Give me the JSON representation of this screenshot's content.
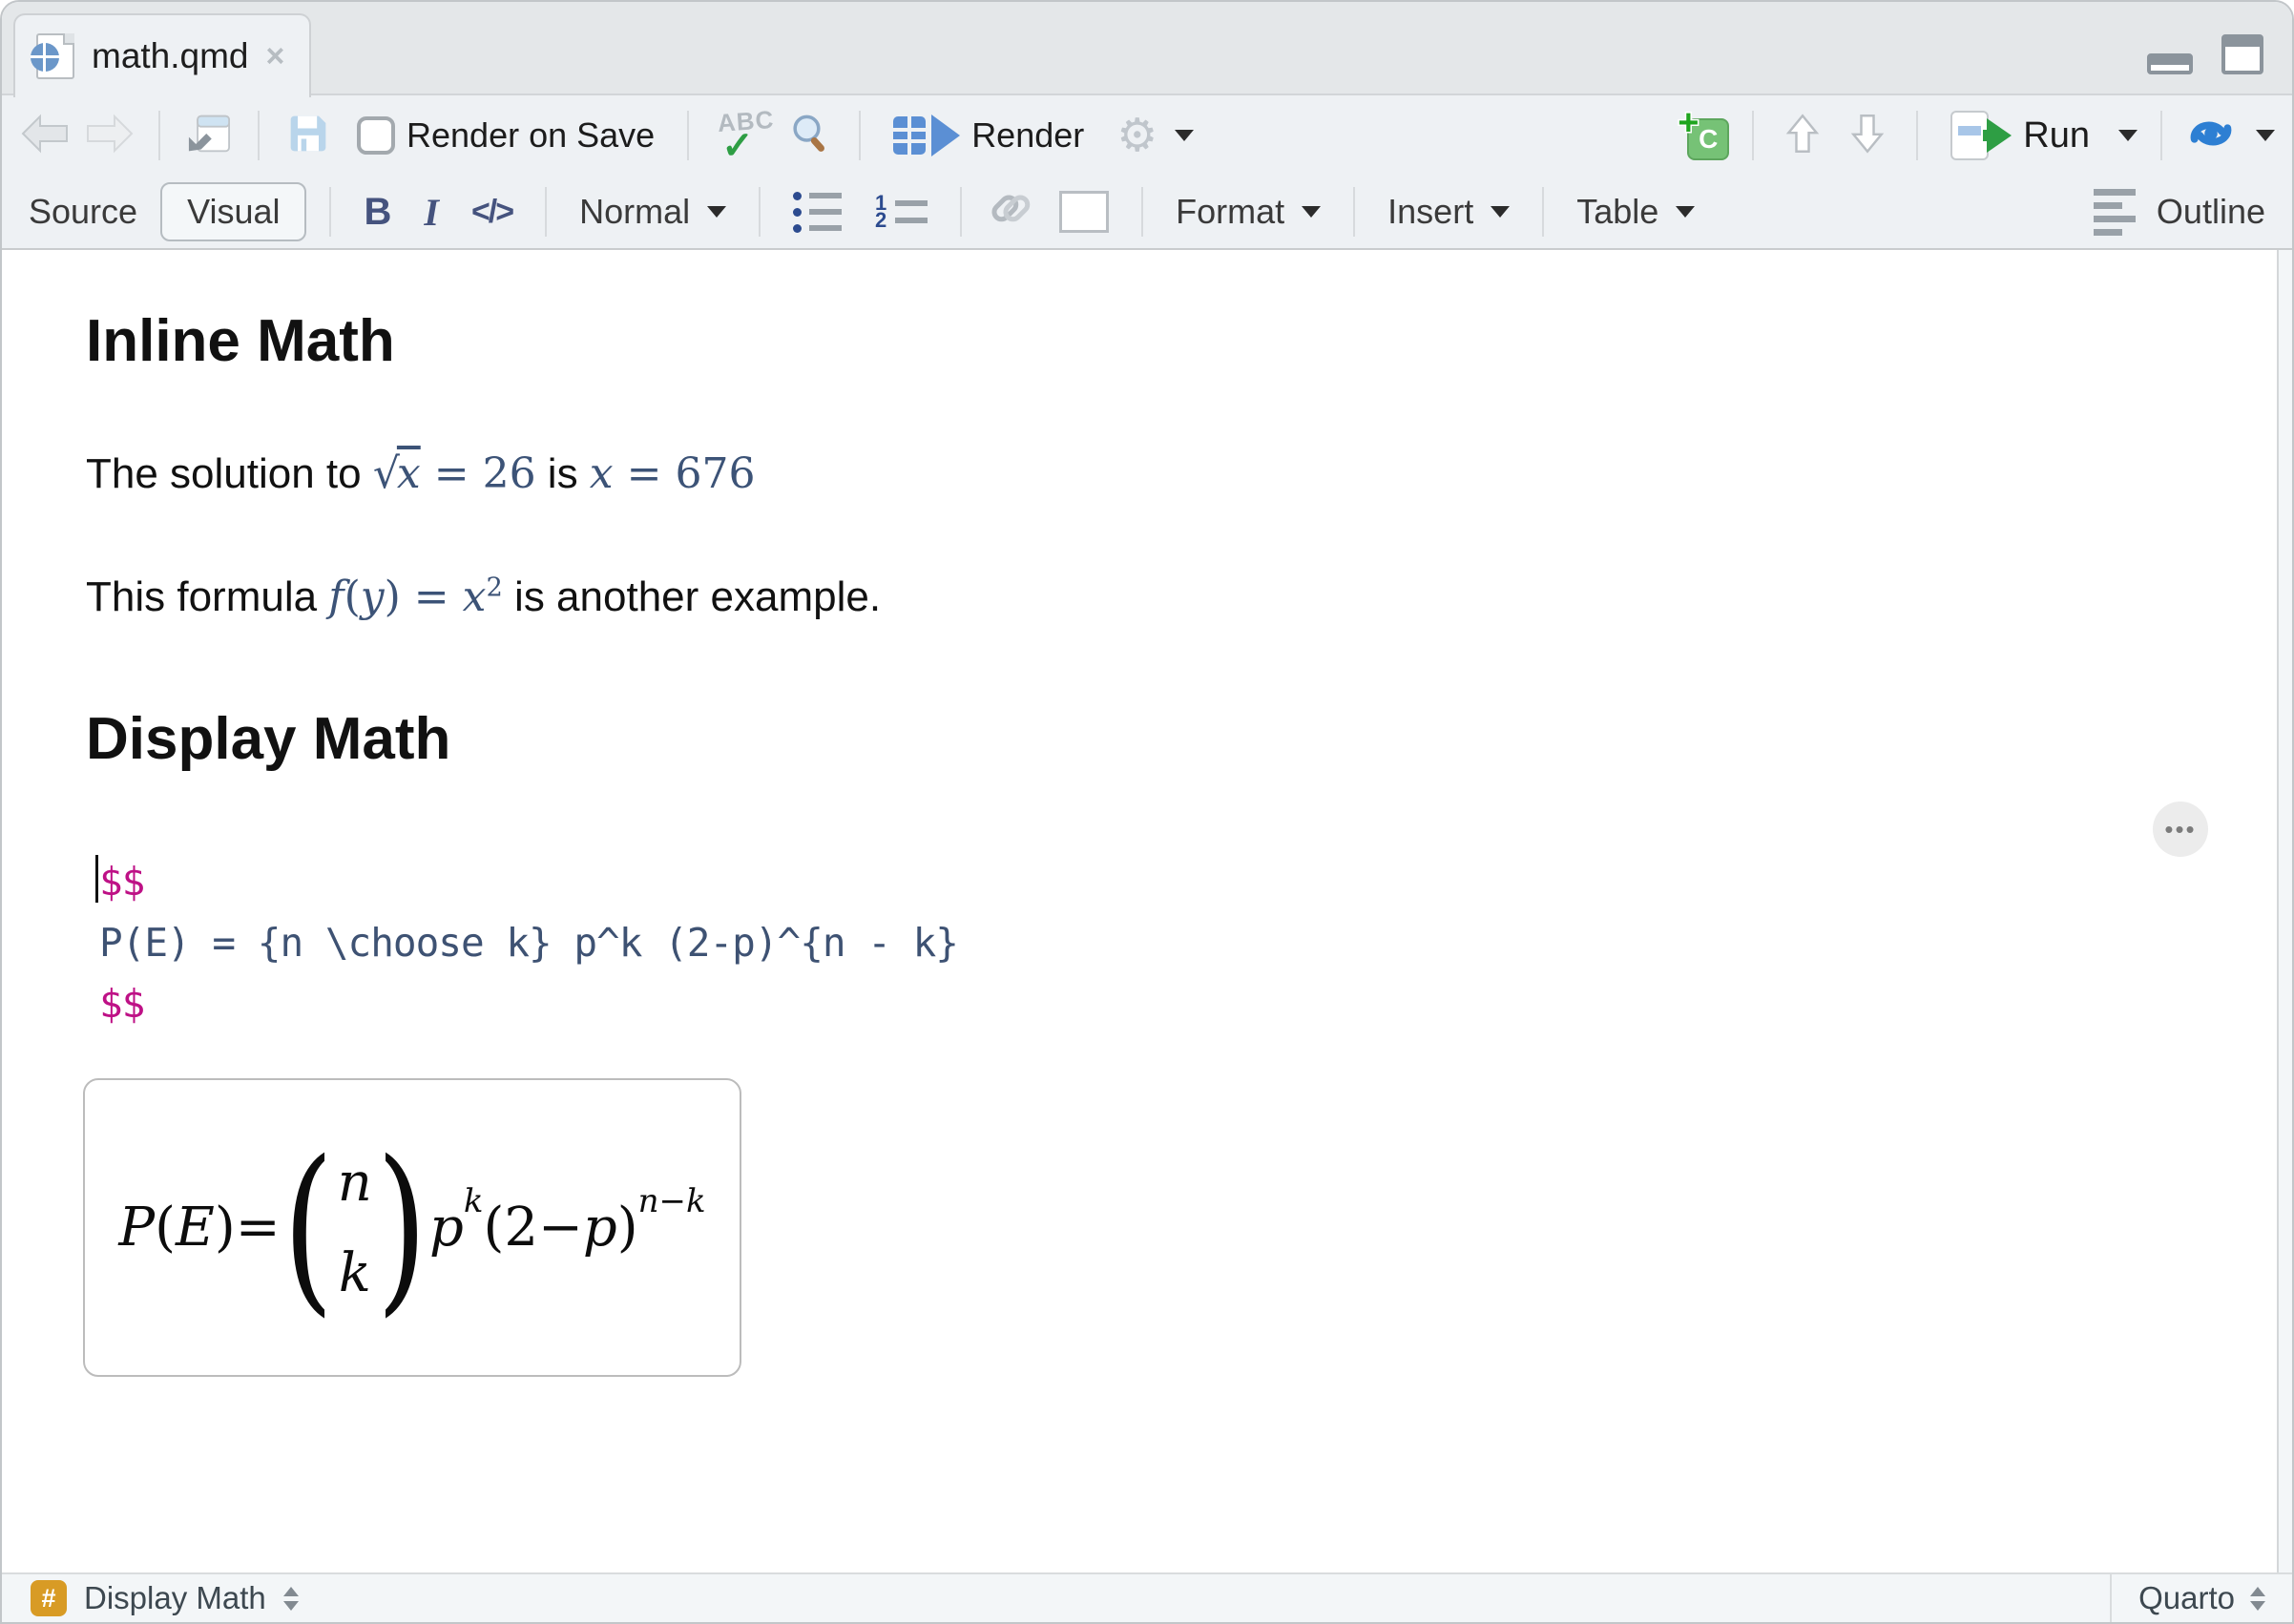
{
  "colors": {
    "math_blue": "#3C5377",
    "code_math_blue": "#3E5273",
    "dollar_magenta": "#BE1186",
    "hash_badge_orange": "#D89B25",
    "run_arrow_green": "#2E9E44",
    "chunk_green": "#76C276",
    "render_blue": "#5B8FD4",
    "sync_blue": "#2D7FD3",
    "toolbar_bg": "#EEF1F4",
    "tabbar_bg": "#E4E7E9"
  },
  "tab": {
    "title": "math.qmd",
    "close_glyph": "×"
  },
  "toolbar": {
    "render_on_save": "Render on Save",
    "spellcheck_abc": "ABC",
    "spellcheck_check": "✓",
    "render": "Render",
    "gear_glyph": "⚙",
    "chunk_plus": "+",
    "chunk_c": "C",
    "run": "Run"
  },
  "formatbar": {
    "source": "Source",
    "visual": "Visual",
    "bold": "B",
    "italic": "I",
    "code": "</>",
    "style": "Normal",
    "format": "Format",
    "insert": "Insert",
    "table": "Table",
    "outline": "Outline"
  },
  "doc": {
    "h1_inline": "Inline Math",
    "p1_before": "The solution to ",
    "p1_sqrt": "√",
    "p1_sqrt_arg": "x",
    "p1_math1_rest": " = 26",
    "p1_mid": " is ",
    "p1_math2_var": "x",
    "p1_math2_rest": " = 676",
    "p2_before": "This formula ",
    "p2_f": "f",
    "p2_open": "(",
    "p2_y": "y",
    "p2_close": ")",
    "p2_eq": " = ",
    "p2_x": "x",
    "p2_sup": "2",
    "p2_after": " is another example.",
    "h1_display": "Display Math",
    "code": {
      "line1": "$$",
      "line2": "P(E) = {n \\choose k} p^k (2-p)^{n - k}",
      "line3": "$$"
    },
    "ellipsis": "•••",
    "eq": {
      "P": "P",
      "open": "(",
      "E": "E",
      "close": ")",
      "equals": " = ",
      "paren_open": "(",
      "paren_close": ")",
      "binom_top": "n",
      "binom_bottom": "k",
      "p": "p",
      "sup_k": "k",
      "open2": "(",
      "two": "2",
      "minus": " − ",
      "p2": "p",
      "close2": ")",
      "sup_nk": "n−k"
    }
  },
  "statusbar": {
    "hash": "#",
    "block_type": "Display Math",
    "mode": "Quarto"
  }
}
